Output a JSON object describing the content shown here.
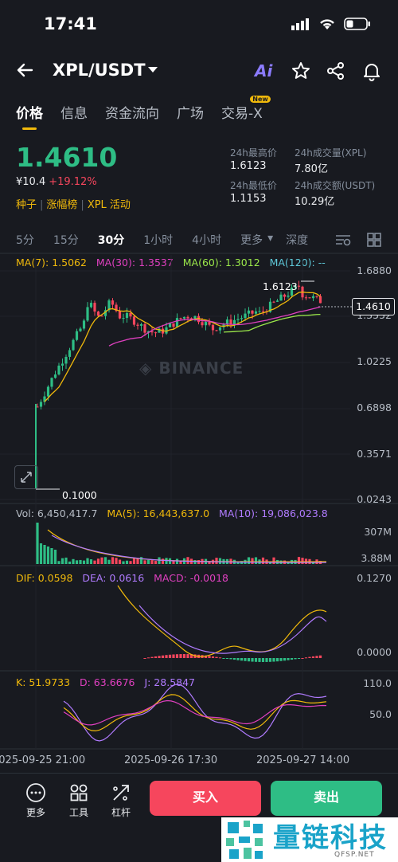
{
  "status": {
    "time": "17:41"
  },
  "header": {
    "pair": "XPL/USDT",
    "ai_label": "Ai"
  },
  "tabs": [
    {
      "label": "价格",
      "active": true
    },
    {
      "label": "信息"
    },
    {
      "label": "资金流向"
    },
    {
      "label": "广场"
    },
    {
      "label": "交易-X",
      "badge": "New"
    }
  ],
  "ticker": {
    "price": "1.4610",
    "fiat": "¥10.4",
    "change": "+19.12%",
    "tags": [
      "种子",
      "涨幅榜",
      "XPL 活动"
    ],
    "high_label": "24h最高价",
    "high": "1.6123",
    "low_label": "24h最低价",
    "low": "1.1153",
    "vol_label": "24h成交量(XPL)",
    "vol": "7.80亿",
    "amt_label": "24h成交额(USDT)",
    "amt": "10.29亿"
  },
  "intervals": [
    "5分",
    "15分",
    "30分",
    "1小时",
    "4小时",
    "更多",
    "深度"
  ],
  "active_interval": "30分",
  "ma_row": {
    "ma7": "MA(7): 1.5062",
    "ma30": "MA(30): 1.3537",
    "ma60": "MA(60): 1.3012",
    "ma120": "MA(120): --"
  },
  "price_axis": [
    "1.6880",
    "1.3552",
    "1.0225",
    "0.6898",
    "0.3571",
    "0.0243"
  ],
  "price_annotations": {
    "high": "1.6123",
    "low": "0.1000",
    "current": "1.4610"
  },
  "watermark": "BINANCE",
  "volume_row": {
    "vol": "Vol: 6,450,417.7",
    "ma5": "MA(5): 16,443,637.0",
    "ma10": "MA(10): 19,086,023.8",
    "axis_top": "307M",
    "axis_bottom": "3.88M"
  },
  "macd_row": {
    "dif": "DIF: 0.0598",
    "dea": "DEA: 0.0616",
    "macd": "MACD: -0.0018",
    "axis_top": "0.1270",
    "axis_bottom": "0.0000"
  },
  "kdj_row": {
    "k": "K: 51.9733",
    "d": "D: 63.6676",
    "j": "J: 28.5847",
    "axis_top": "110.0",
    "axis_mid": "50.0"
  },
  "x_axis": [
    "2025-09-25 21:00",
    "2025-09-26 17:30",
    "2025-09-27 14:00"
  ],
  "bottom_bar": {
    "more": "更多",
    "tools": "工具",
    "leverage": "杠杆",
    "buy": "买入",
    "sell": "卖出"
  },
  "ad": {
    "title": "量链科技",
    "url": "QFSP.NET"
  },
  "colors": {
    "up": "#2ebd85",
    "down": "#f6465d",
    "accent": "#f0b90b",
    "ma7": "#f0b90b",
    "ma30": "#e040c0",
    "ma60": "#9be84a",
    "ma120": "#5ec8d8",
    "dea": "#b07bff"
  }
}
